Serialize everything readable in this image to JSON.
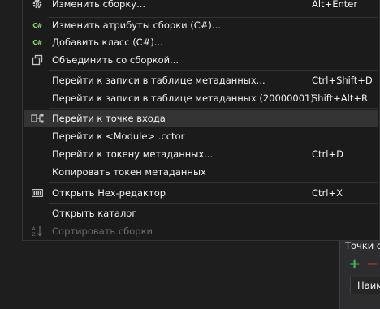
{
  "menu": {
    "items": [
      {
        "label": "Изменить сборку...",
        "shortcut": "Alt+Enter",
        "icon": "gear-icon"
      },
      {
        "label": "Изменить атрибуты сборки (C#)...",
        "shortcut": "",
        "icon": "csharp-icon",
        "icon_text": "C#"
      },
      {
        "label": "Добавить класс (C#)...",
        "shortcut": "",
        "icon": "csharp-icon",
        "icon_text": "C#"
      },
      {
        "label": "Объединить со сборкой...",
        "shortcut": "",
        "icon": "merge-icon"
      },
      {
        "label": "Перейти к записи в таблице метаданных...",
        "shortcut": "Ctrl+Shift+D"
      },
      {
        "label": "Перейти к записи в таблице метаданных (20000001)",
        "shortcut": "Shift+Alt+R"
      },
      {
        "label": "Перейти к точке входа",
        "shortcut": "",
        "icon": "entry-point-icon"
      },
      {
        "label": "Перейти к <Module> .cctor",
        "shortcut": ""
      },
      {
        "label": "Перейти к токену метаданных...",
        "shortcut": "Ctrl+D"
      },
      {
        "label": "Копировать токен метаданных",
        "shortcut": ""
      },
      {
        "label": "Открыть Hex-редактор",
        "shortcut": "Ctrl+X",
        "icon": "hex-editor-icon"
      },
      {
        "label": "Открыть каталог",
        "shortcut": ""
      },
      {
        "label": "Сортировать сборки",
        "shortcut": "",
        "icon": "sort-icon"
      }
    ]
  },
  "panel": {
    "title": "Точки о",
    "column_header": "Наим"
  },
  "colors": {
    "menu_bg": "#1b1b1c",
    "highlight": "#333334",
    "text": "#f1f1f1",
    "disabled_text": "#6d6d6d",
    "csharp_green": "#8cd36b"
  }
}
